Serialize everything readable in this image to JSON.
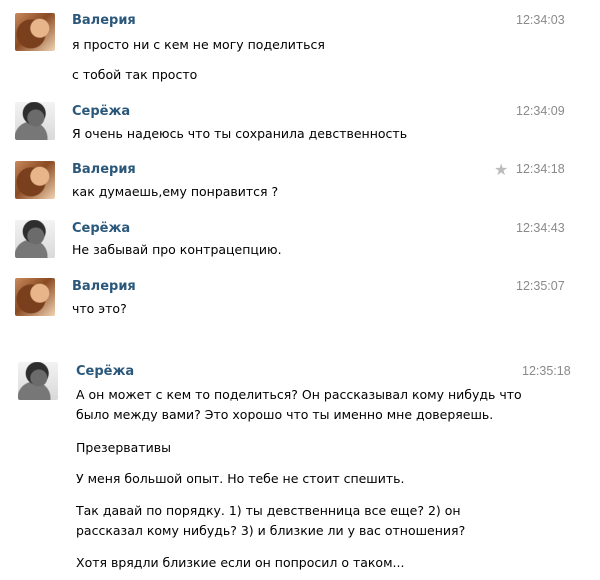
{
  "icons": {
    "star": "star-icon"
  },
  "colors": {
    "name": "#2b587a",
    "time": "#8a8a8a",
    "star": "#bcbcbc"
  },
  "messages": [
    {
      "author": "Валерия",
      "time": "12:34:03",
      "lines": [
        "я просто ни с кем не могу поделиться",
        "с тобой так просто"
      ]
    },
    {
      "author": "Серёжа",
      "time": "12:34:09",
      "lines": [
        "Я очень надеюсь что ты сохранила девственность"
      ]
    },
    {
      "author": "Валерия",
      "time": "12:34:18",
      "lines": [
        "как думаешь,ему понравится ?"
      ]
    },
    {
      "author": "Серёжа",
      "time": "12:34:43",
      "lines": [
        "Не забывай про контрацепцию."
      ]
    },
    {
      "author": "Валерия",
      "time": "12:35:07",
      "lines": [
        "что это?"
      ]
    },
    {
      "author": "Серёжа",
      "time": "12:35:18",
      "lines": [
        "А он может с кем то поделиться? Он рассказывал кому нибудь что",
        "было между вами? Это хорошо что ты именно мне доверяешь.",
        "Презервативы",
        "У меня большой опыт. Но тебе не стоит спешить.",
        "Так давай по порядку.  1) ты девственница все еще? 2) он",
        "рассказал кому нибудь? 3) и близкие ли у вас отношения?",
        "Хотя врядли близкие если он попросил о таком..."
      ]
    }
  ]
}
